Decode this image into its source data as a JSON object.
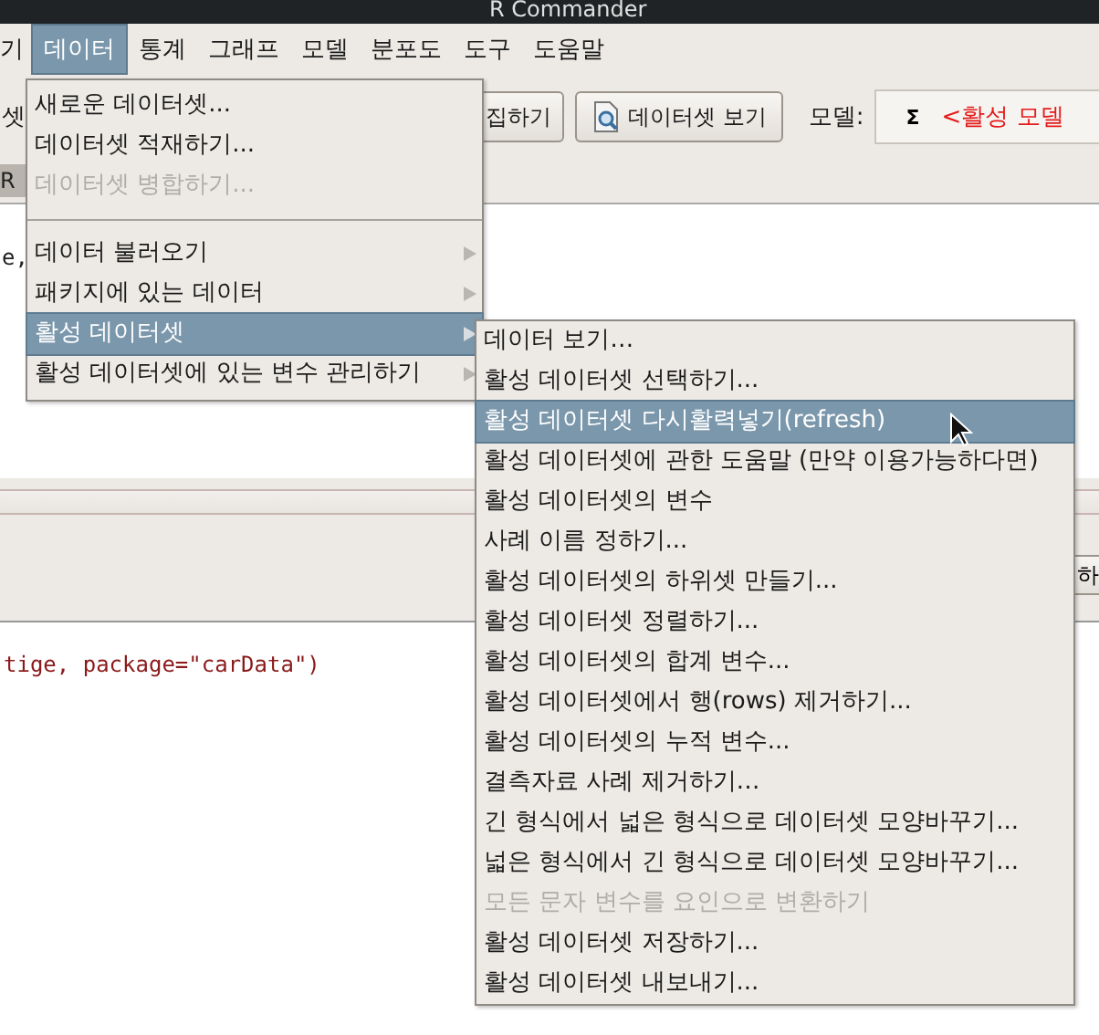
{
  "title_bar": {
    "title": "R Commander"
  },
  "menu_bar": [
    {
      "label": "기",
      "selected": false
    },
    {
      "label": "데이터",
      "selected": true
    },
    {
      "label": "통계",
      "selected": false
    },
    {
      "label": "그래프",
      "selected": false
    },
    {
      "label": "모델",
      "selected": false
    },
    {
      "label": "분포도",
      "selected": false
    },
    {
      "label": "도구",
      "selected": false
    },
    {
      "label": "도움말",
      "selected": false
    }
  ],
  "toolbar": {
    "dataset_label": "셋",
    "edit_button": "집하기",
    "view_button": "데이터셋 보기",
    "model_label": "모델:",
    "model_symbol": "Σ",
    "model_value": "<활성 모델"
  },
  "script_tab": "R",
  "script_text": "e,",
  "submit_button": "하",
  "output_text": "tige, package=\"carData\")",
  "data_menu": [
    {
      "kind": "item",
      "label": "새로운 데이터셋...",
      "disabled": false,
      "submenu": false,
      "selected": false
    },
    {
      "kind": "item",
      "label": "데이터셋 적재하기...",
      "disabled": false,
      "submenu": false,
      "selected": false
    },
    {
      "kind": "item",
      "label": "데이터셋 병합하기...",
      "disabled": true,
      "submenu": false,
      "selected": false
    },
    {
      "kind": "separator"
    },
    {
      "kind": "item",
      "label": "데이터 불러오기",
      "disabled": false,
      "submenu": true,
      "selected": false
    },
    {
      "kind": "item",
      "label": "패키지에 있는 데이터",
      "disabled": false,
      "submenu": true,
      "selected": false
    },
    {
      "kind": "item",
      "label": "활성 데이터셋",
      "disabled": false,
      "submenu": true,
      "selected": true
    },
    {
      "kind": "item",
      "label": "활성 데이터셋에 있는 변수 관리하기",
      "disabled": false,
      "submenu": true,
      "selected": false
    }
  ],
  "submenu": [
    {
      "label": "데이터 보기…",
      "disabled": false,
      "selected": false
    },
    {
      "label": "활성 데이터셋 선택하기...",
      "disabled": false,
      "selected": false
    },
    {
      "label": "활성 데이터셋 다시활력넣기(refresh)",
      "disabled": false,
      "selected": true
    },
    {
      "label": "활성 데이터셋에 관한 도움말 (만약 이용가능하다면)",
      "disabled": false,
      "selected": false
    },
    {
      "label": "활성 데이터셋의 변수",
      "disabled": false,
      "selected": false
    },
    {
      "label": "사례 이름 정하기...",
      "disabled": false,
      "selected": false
    },
    {
      "label": "활성 데이터셋의 하위셋 만들기...",
      "disabled": false,
      "selected": false
    },
    {
      "label": "활성 데이터셋 정렬하기...",
      "disabled": false,
      "selected": false
    },
    {
      "label": "활성 데이터셋의 합계 변수...",
      "disabled": false,
      "selected": false
    },
    {
      "label": "활성 데이터셋에서 행(rows) 제거하기...",
      "disabled": false,
      "selected": false
    },
    {
      "label": "활성 데이터셋의 누적 변수...",
      "disabled": false,
      "selected": false
    },
    {
      "label": "결측자료 사례 제거하기…",
      "disabled": false,
      "selected": false
    },
    {
      "label": "긴 형식에서 넓은 형식으로 데이터셋 모양바꾸기...",
      "disabled": false,
      "selected": false
    },
    {
      "label": "넓은 형식에서 긴 형식으로 데이터셋 모양바꾸기...",
      "disabled": false,
      "selected": false
    },
    {
      "label": "모든 문자 변수를 요인으로 변환하기",
      "disabled": true,
      "selected": false
    },
    {
      "label": "활성 데이터셋 저장하기...",
      "disabled": false,
      "selected": false
    },
    {
      "label": "활성 데이터셋 내보내기...",
      "disabled": false,
      "selected": false
    }
  ]
}
